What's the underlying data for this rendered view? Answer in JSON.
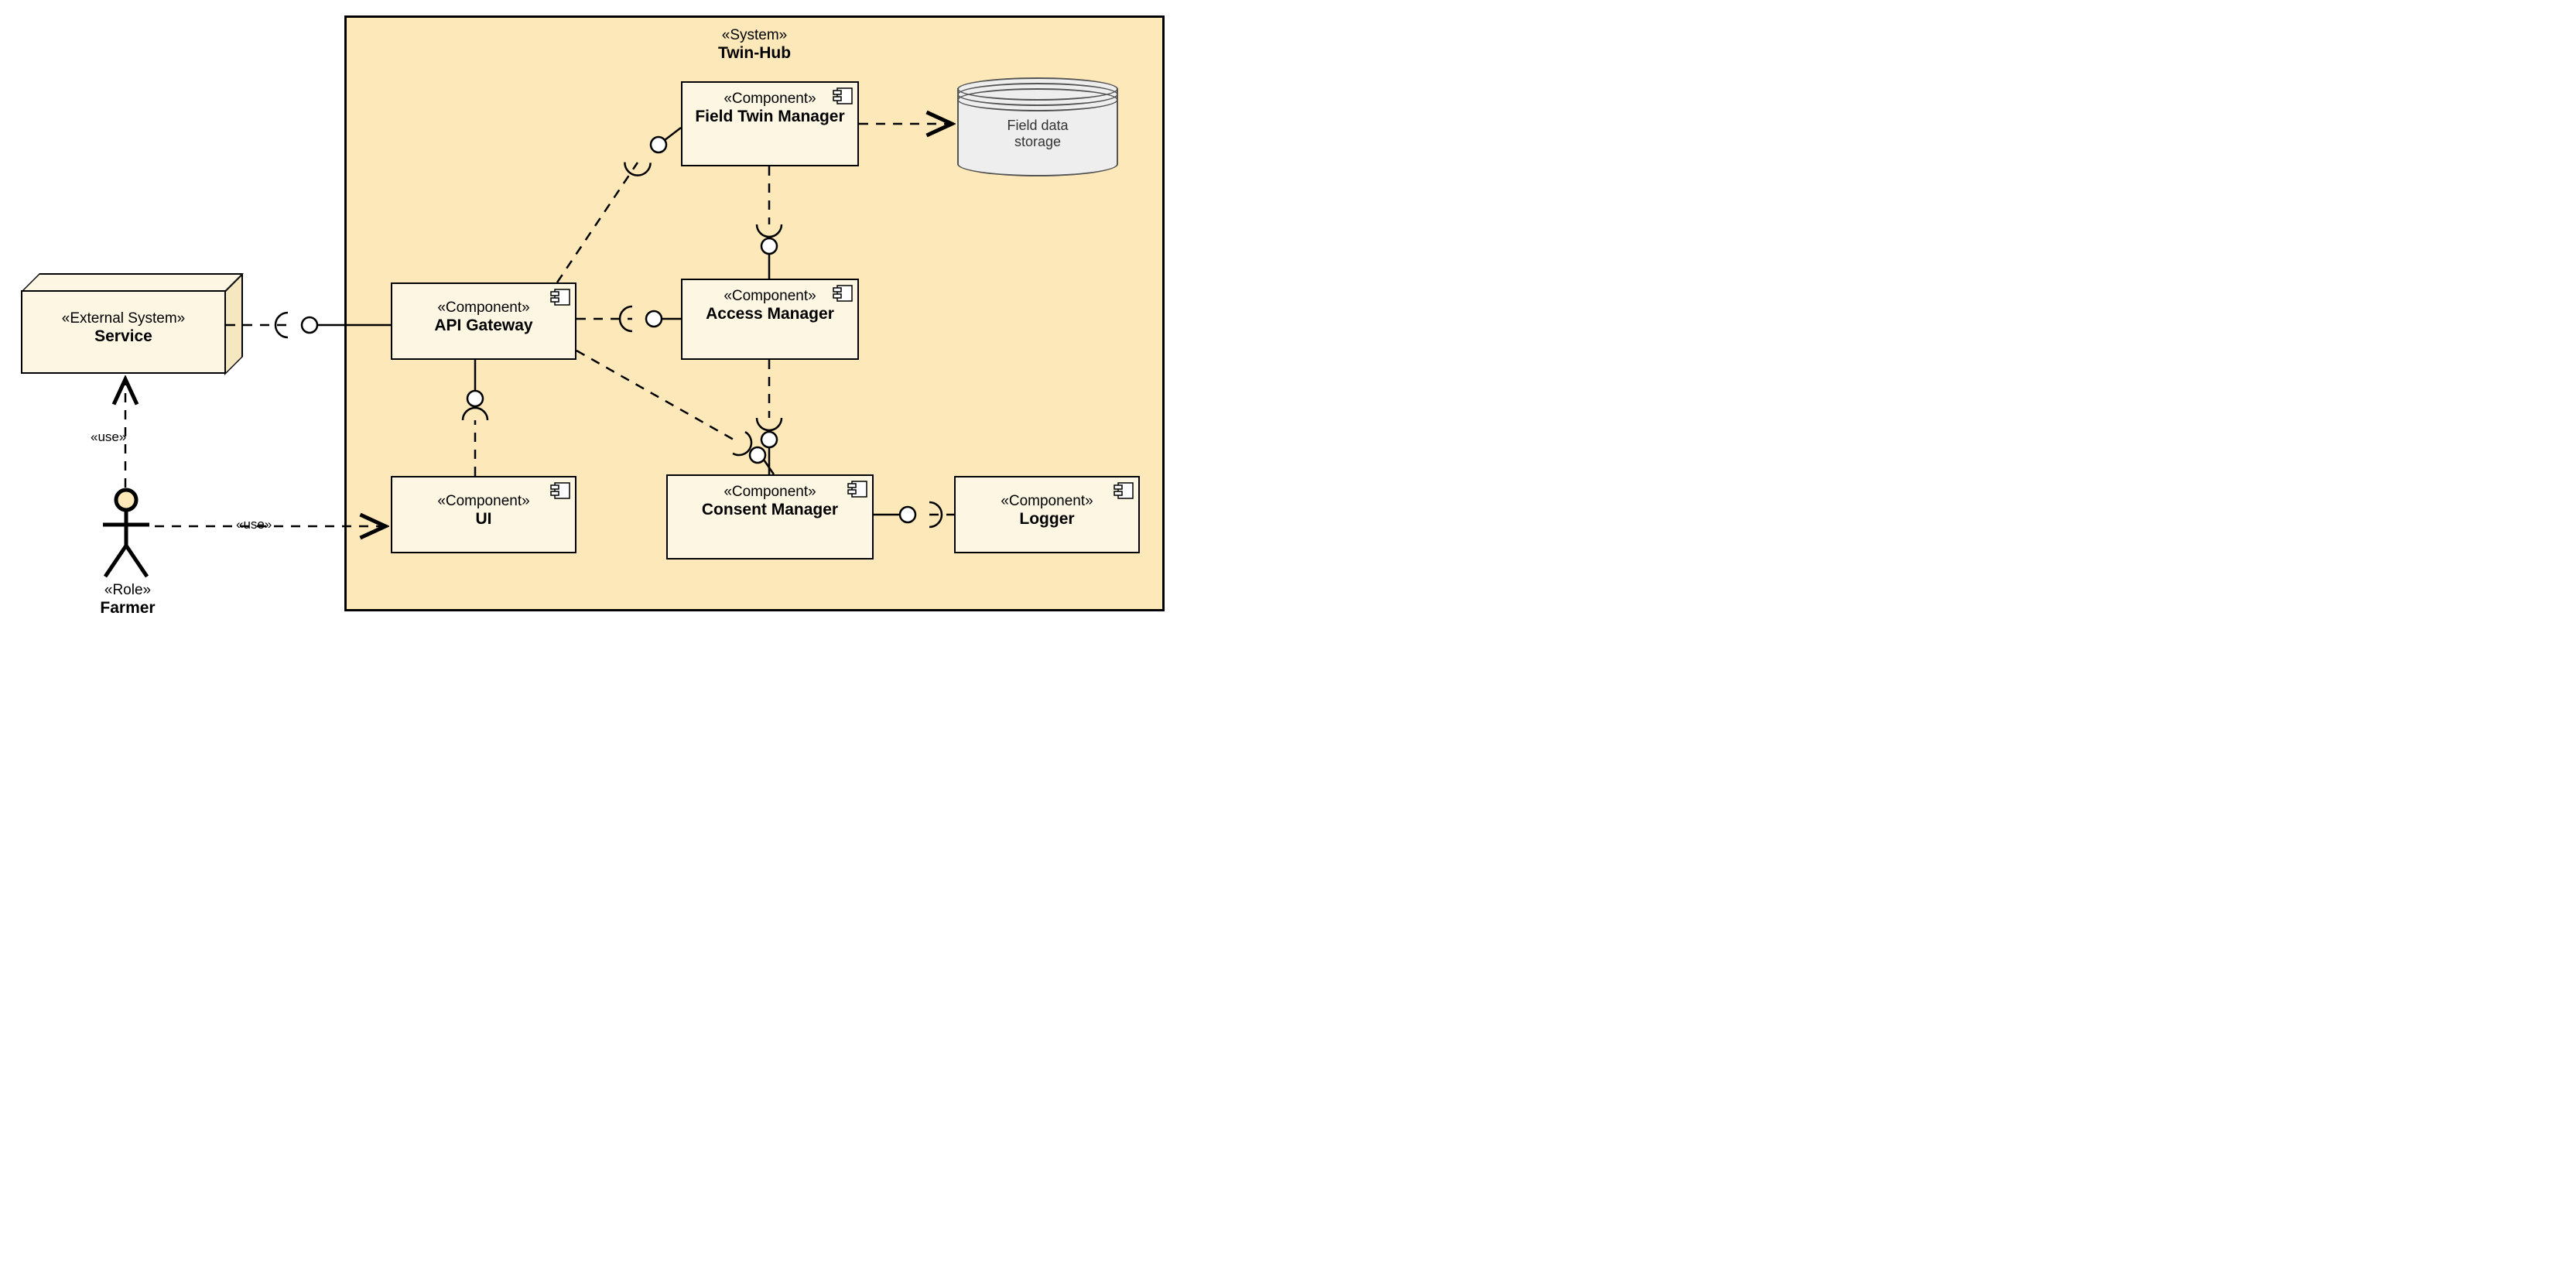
{
  "system": {
    "stereotype": "«System»",
    "name": "Twin-Hub"
  },
  "external": {
    "stereotype": "«External System»",
    "name": "Service"
  },
  "actor": {
    "stereotype": "«Role»",
    "name": "Farmer"
  },
  "components": {
    "api": {
      "stereotype": "«Component»",
      "name": "API Gateway"
    },
    "ftm": {
      "stereotype": "«Component»",
      "name": "Field Twin Manager"
    },
    "access": {
      "stereotype": "«Component»",
      "name": "Access Manager"
    },
    "consent": {
      "stereotype": "«Component»",
      "name": "Consent Manager"
    },
    "logger": {
      "stereotype": "«Component»",
      "name": "Logger"
    },
    "ui": {
      "stereotype": "«Component»",
      "name": "UI"
    }
  },
  "storage": {
    "name_l1": "Field data",
    "name_l2": "storage"
  },
  "edges": {
    "farmer_service": "«use»",
    "farmer_ui": "«use»"
  }
}
